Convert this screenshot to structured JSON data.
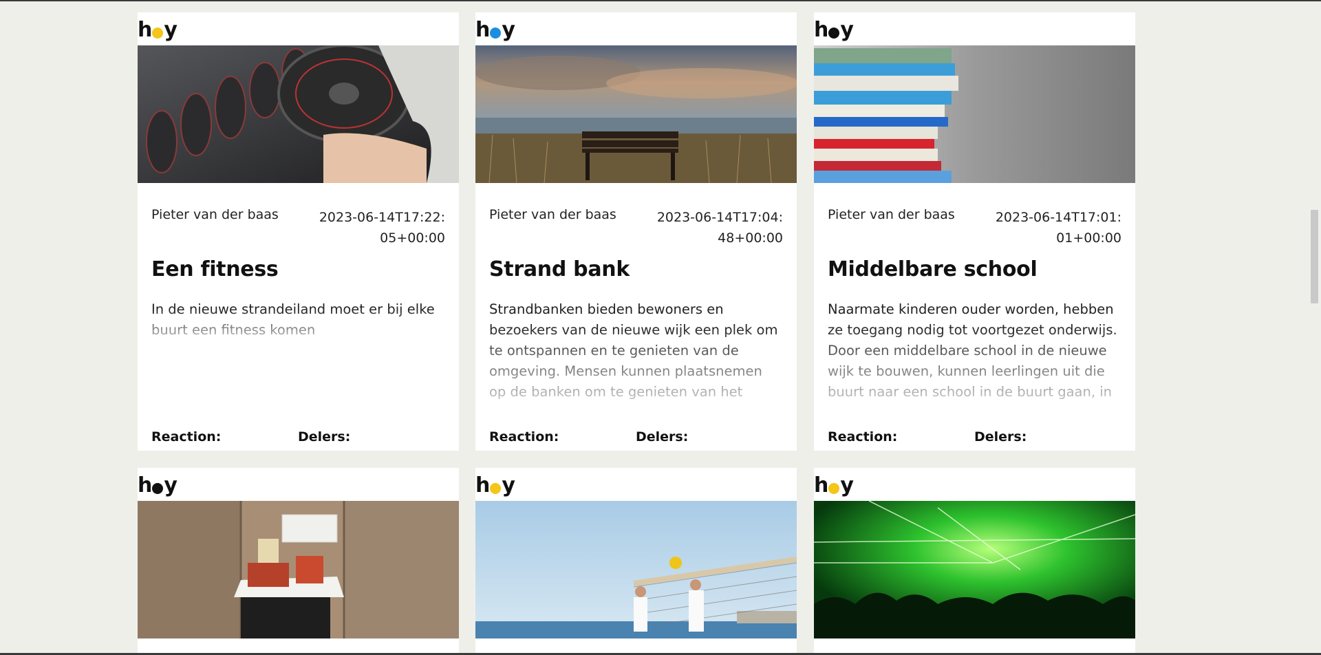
{
  "colors": {
    "page_bg": "#efefea",
    "card_bg": "#ffffff",
    "logo_dot_yellow": "#f5c518",
    "logo_dot_blue": "#1a8ee0"
  },
  "cards": [
    {
      "logo_prefix": "h",
      "logo_suffix": "y",
      "logo_dot_color": "#f5c518",
      "image": "dumbbell-photo",
      "author": "Pieter van der baas",
      "date": "2023-06-14T17:22:05+00:00",
      "title": "Een fitness",
      "description": "In de nieuwe strandeiland moet er bij elke buurt een fitness komen",
      "reaction_label": "Reaction:",
      "delers_label": "Delers:"
    },
    {
      "logo_prefix": "h",
      "logo_suffix": "y",
      "logo_dot_color": "#1a8ee0",
      "image": "beach-bench-photo",
      "author": "Pieter van der baas",
      "date": "2023-06-14T17:04:48+00:00",
      "title": "Strand bank",
      "description": "Strandbanken bieden bewoners en bezoekers van de nieuwe wijk een plek om te ontspannen en te genieten van de omgeving. Mensen kunnen plaatsnemen op de banken om te genieten van het",
      "reaction_label": "Reaction:",
      "delers_label": "Delers:"
    },
    {
      "logo_prefix": "h",
      "logo_suffix": "y",
      "logo_dot_color": "#111111",
      "image": "book-stack-photo",
      "author": "Pieter van der baas",
      "date": "2023-06-14T17:01:01+00:00",
      "title": "Middelbare school",
      "description": "Naarmate kinderen ouder worden, hebben ze toegang nodig tot voortgezet onderwijs. Door een middelbare school in de nieuwe wijk te bouwen, kunnen leerlingen uit die buurt naar een school in de buurt gaan, in",
      "reaction_label": "Reaction:",
      "delers_label": "Delers:"
    },
    {
      "logo_prefix": "h",
      "logo_suffix": "y",
      "logo_dot_color": "#111111",
      "image": "trash-can-photo"
    },
    {
      "logo_prefix": "h",
      "logo_suffix": "y",
      "logo_dot_color": "#f5c518",
      "image": "beach-volleyball-photo"
    },
    {
      "logo_prefix": "h",
      "logo_suffix": "y",
      "logo_dot_color": "#f5c518",
      "image": "concert-lasers-photo"
    }
  ]
}
